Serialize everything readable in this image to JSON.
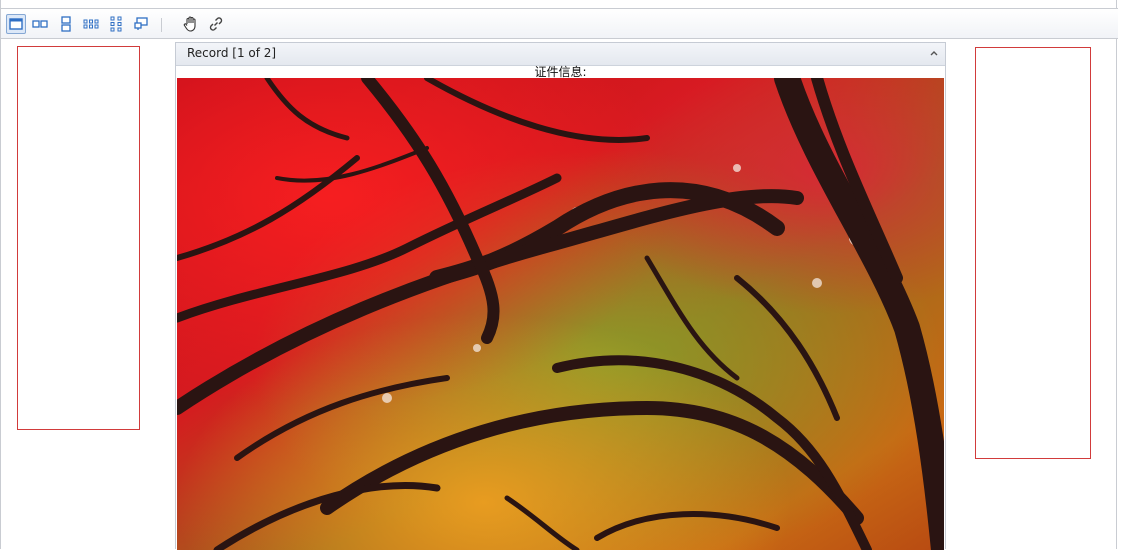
{
  "toolbar": {
    "buttons": [
      {
        "icon": "single-page-view-icon",
        "active": true
      },
      {
        "icon": "two-page-view-icon",
        "active": false
      },
      {
        "icon": "vertical-two-page-icon",
        "active": false
      },
      {
        "icon": "multi-page-row-icon",
        "active": false
      },
      {
        "icon": "multi-page-grid-icon",
        "active": false
      },
      {
        "icon": "fit-page-icon",
        "active": false
      },
      {
        "icon": "hand-tool-icon",
        "active": false
      },
      {
        "icon": "link-icon",
        "active": false
      }
    ]
  },
  "record": {
    "title": "Record [1 of 2]",
    "caption": "证件信息:",
    "photo_subject": "red and orange maple tree canopy"
  },
  "colors": {
    "frame_border": "#d13b3b",
    "toolbar_accent": "#2f6fc4"
  }
}
